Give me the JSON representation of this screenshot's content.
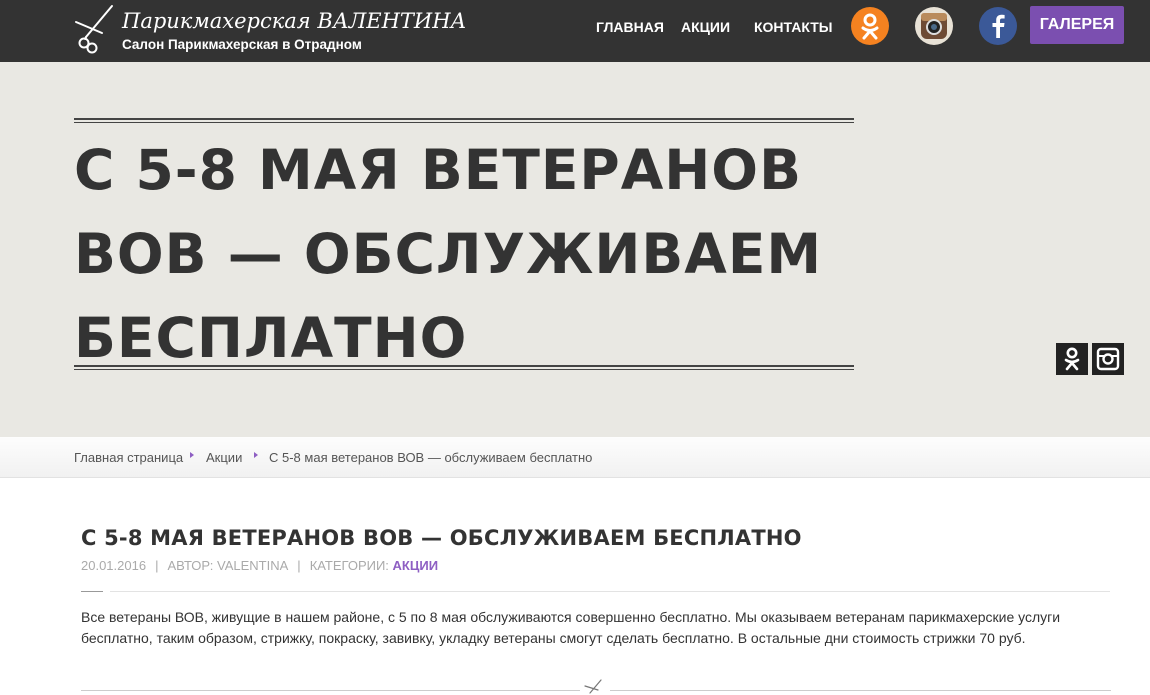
{
  "header": {
    "logo_title": "Парикмахерская ВАЛЕНТИНА",
    "logo_subtitle": "Салон Парикмахерская в Отрадном",
    "nav": [
      "ГЛАВНАЯ",
      "АКЦИИ",
      "КОНТАКТЫ"
    ],
    "social_icons": [
      "odnoklassniki-icon",
      "instagram-icon",
      "facebook-icon"
    ],
    "gallery_label": "ГАЛЕРЕЯ"
  },
  "hero": {
    "title_lines": [
      "С 5-8 МАЯ ВЕТЕРАНОВ",
      "ВОВ — ОБСЛУЖИВАЕМ",
      "БЕСПЛАТНО"
    ],
    "social_icons": [
      "odnoklassniki-icon",
      "instagram-icon"
    ]
  },
  "breadcrumb": {
    "items": [
      "Главная страница",
      "Акции",
      "С 5-8 мая ветеранов ВОВ — обслуживаем бесплатно"
    ]
  },
  "post": {
    "title": "С 5-8 МАЯ ВЕТЕРАНОВ ВОВ — ОБСЛУЖИВАЕМ БЕСПЛАТНО",
    "date": "20.01.2016",
    "author": "АВТОР: VALENTINA",
    "categories_label": "КАТЕГОРИИ:",
    "category": "АКЦИИ",
    "body": "Все ветераны ВОВ, живущие в нашем районе, с 5 по 8 мая обслуживаются совершенно бесплатно. Мы оказываем ветеранам парикмахерские услуги бесплатно, таким образом, стрижку, покраску, завивку, укладку ветераны смогут сделать бесплатно. В остальные дни стоимость стрижки 70 руб."
  },
  "colors": {
    "header_bg": "#333333",
    "accent": "#7b4fb0",
    "hero_bg": "#e9e8e3"
  }
}
